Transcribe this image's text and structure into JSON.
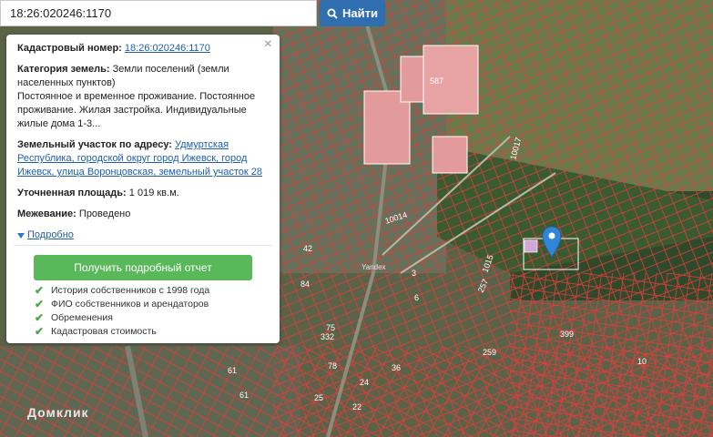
{
  "search": {
    "value": "18:26:020246:1170",
    "button_label": "Найти",
    "icon": "search-icon"
  },
  "popup": {
    "cadastral_label": "Кадастровый номер:",
    "cadastral_value": "18:26:020246:1170",
    "category_label": "Категория земель:",
    "category_value": "Земли поселений (земли населенных пунктов)",
    "usage_text": "Постоянное и временное проживание. Постоянное проживание. Жилая застройка. Индивидуальные жилые дома 1-3...",
    "address_label": "Земельный участок по адресу:",
    "address_value": "Удмуртская Республика, городской округ город Ижевск, город Ижевск, улица Воронцовская, земельный участок 28",
    "area_label": "Уточненная площадь:",
    "area_value": "1 019 кв.м.",
    "survey_label": "Межевание:",
    "survey_value": "Проведено",
    "more_link": "Подробно",
    "report_button": "Получить подробный отчет",
    "features": [
      "История собственников с 1998 года",
      "ФИО собственников и арендаторов",
      "Обременения",
      "Кадастровая стоимость"
    ]
  },
  "map": {
    "labels": [
      "587",
      "10014",
      "10017",
      "3",
      "6",
      "257",
      "259",
      "1015",
      "399",
      "10",
      "75",
      "332",
      "24",
      "25",
      "22",
      "61",
      "42",
      "84",
      "36",
      "61",
      "78"
    ],
    "watermark": "Домклик",
    "yandex_label": "Yandex",
    "colors": {
      "parcel_outline": "#e23b3b",
      "marker": "#2f86d6",
      "building_roof": "#e79a9a"
    }
  }
}
